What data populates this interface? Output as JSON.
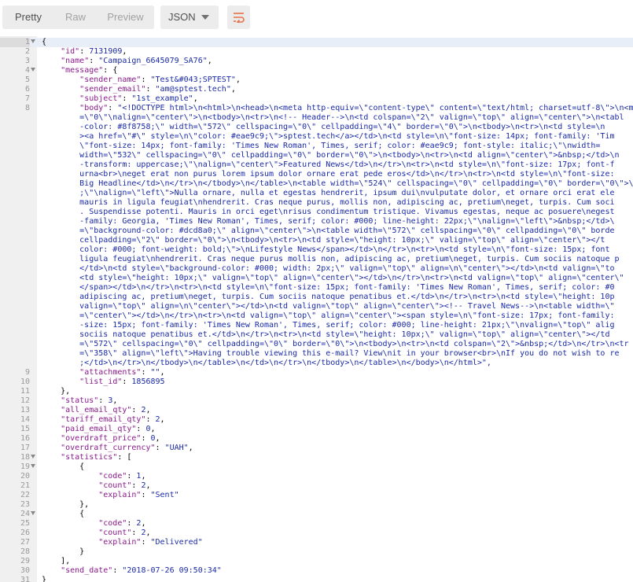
{
  "toolbar": {
    "view_tabs": [
      {
        "label": "Pretty",
        "active": true
      },
      {
        "label": "Raw",
        "active": false
      },
      {
        "label": "Preview",
        "active": false
      }
    ],
    "format_select": "JSON",
    "wrap_icon": "wrap-lines-icon",
    "accent_color": "#e8724a"
  },
  "editor": {
    "colors": {
      "key": "#8a1a8a",
      "string": "#1a2aa6",
      "number": "#1a2aa6",
      "gutter_bg": "#f0f0f0",
      "active_line": "#e8eef8"
    },
    "lines": [
      {
        "no": "1",
        "fold": true,
        "text": "{"
      },
      {
        "no": "2",
        "fold": false,
        "text": "    \"id\": 7131909,"
      },
      {
        "no": "3",
        "fold": false,
        "text": "    \"name\": \"Campaign_6645079_SA76\","
      },
      {
        "no": "4",
        "fold": true,
        "text": "    \"message\": {"
      },
      {
        "no": "5",
        "fold": false,
        "text": "        \"sender_name\": \"Test&#043;SPTEST\","
      },
      {
        "no": "6",
        "fold": false,
        "text": "        \"sender_email\": \"am@sptest.tech\","
      },
      {
        "no": "7",
        "fold": false,
        "text": "        \"subject\": \"1st_example\","
      },
      {
        "no": "8",
        "fold": false,
        "text": "        \"body\": \"<!DOCTYPE html>\\n<html>\\n<head>\\n<meta http-equiv=\\\"content-type\\\" content=\\\"text/html; charset=utf-8\\\">\\n<m"
      },
      {
        "no": "",
        "fold": false,
        "text": "        =\\\"0\\\"\\nalign=\\\"center\\\">\\n<tbody>\\n<tr>\\n<!-- Header-->\\n<td colspan=\\\"2\\\" valign=\\\"top\\\" align=\\\"center\\\">\\n<tabl"
      },
      {
        "no": "",
        "fold": false,
        "text": "        -color: #8f8758;\\\" width=\\\"572\\\" cellspacing=\\\"0\\\" cellpadding=\\\"4\\\" border=\\\"0\\\">\\n<tbody>\\n<tr>\\n<td style=\\n"
      },
      {
        "no": "",
        "fold": false,
        "text": "        ><a href=\\\"#\\\" style=\\n\\\"color: #eae9c9;\\\">sptest.tech</a></td>\\n<td style=\\n\\\"font-size: 14px; font-family: 'Tim"
      },
      {
        "no": "",
        "fold": false,
        "text": "        \\\"font-size: 14px; font-family: 'Times New Roman', Times, serif; color: #eae9c9; font-style: italic;\\\"\\nwidth="
      },
      {
        "no": "",
        "fold": false,
        "text": "        width=\\\"532\\\" cellspacing=\\\"0\\\" cellpadding=\\\"0\\\" border=\\\"0\\\">\\n<tbody>\\n<tr>\\n<td align=\\\"center\\\">&nbsp;</td>\\n"
      },
      {
        "no": "",
        "fold": false,
        "text": "        -transform: uppercase;\\\"\\nalign=\\\"center\\\">Featured News</td>\\n</tr>\\n<tr>\\n<td style=\\n\\\"font-size: 17px; font-f"
      },
      {
        "no": "",
        "fold": false,
        "text": "        urna<br>\\neget erat non purus lorem ipsum dolor ornare erat pede eros</td>\\n</tr>\\n<tr>\\n<td style=\\n\\\"font-size:"
      },
      {
        "no": "",
        "fold": false,
        "text": "        Big Headline</td>\\n</tr>\\n</tbody>\\n</table>\\n<table width=\\\"524\\\" cellspacing=\\\"0\\\" cellpadding=\\\"0\\\" border=\\\"0\\\">\\"
      },
      {
        "no": "",
        "fold": false,
        "text": "        ;\\\"\\nalign=\\\"left\\\">Nulla ornare, nulla et egestas hendrerit, ipsum dui\\nvulputate dolor, et ornare orci erat ele"
      },
      {
        "no": "",
        "fold": false,
        "text": "        mauris in ligula feugiat\\nhendrerit. Cras neque purus, mollis non, adipiscing ac, pretium\\neget, turpis. Cum soci"
      },
      {
        "no": "",
        "fold": false,
        "text": "        . Suspendisse potenti. Mauris in orci eget\\nrisus condimentum tristique. Vivamus egestas, neque ac posuere\\negest"
      },
      {
        "no": "",
        "fold": false,
        "text": "        -family: Georgia, 'Times New Roman', Times, serif; color: #000; line-height: 22px;\\\"\\nalign=\\\"left\\\">&nbsp;</td>\\"
      },
      {
        "no": "",
        "fold": false,
        "text": "        =\\\"background-color: #dcd8a0;\\\" align=\\\"center\\\">\\n<table width=\\\"572\\\" cellspacing=\\\"0\\\" cellpadding=\\\"0\\\" borde"
      },
      {
        "no": "",
        "fold": false,
        "text": "        cellpadding=\\\"2\\\" border=\\\"0\\\">\\n<tbody>\\n<tr>\\n<td style=\\\"height: 10px;\\\" valign=\\\"top\\\" align=\\\"center\\\"></t"
      },
      {
        "no": "",
        "fold": false,
        "text": "        color: #000; font-weight: bold;\\\">\\nLifestyle News</span></td>\\n</tr>\\n<tr>\\n<td style=\\n\\\"font-size: 15px; font"
      },
      {
        "no": "",
        "fold": false,
        "text": "        ligula feugiat\\nhendrerit. Cras neque purus mollis non, adipiscing ac, pretium\\neget, turpis. Cum sociis natoque p"
      },
      {
        "no": "",
        "fold": false,
        "text": "        </td>\\n<td style=\\\"background-color: #000; width: 2px;\\\" valign=\\\"top\\\" align=\\n\\\"center\\\"></td>\\n<td valign=\\\"to"
      },
      {
        "no": "",
        "fold": false,
        "text": "        <td style=\\\"height: 10px;\\\" valign=\\\"top\\\" align=\\\"center\\\"></td>\\n</tr>\\n<tr>\\n<td valign=\\\"top\\\" align=\\\"center\\\""
      },
      {
        "no": "",
        "fold": false,
        "text": "        </span></td>\\n</tr>\\n<tr>\\n<td style=\\n\\\"font-size: 15px; font-family: 'Times New Roman', Times, serif; color: #0"
      },
      {
        "no": "",
        "fold": false,
        "text": "        adipiscing ac, pretium\\neget, turpis. Cum sociis natoque penatibus et.</td>\\n</tr>\\n<tr>\\n<td style=\\\"height: 10p"
      },
      {
        "no": "",
        "fold": false,
        "text": "        valign=\\\"top\\\" align=\\n\\\"center\\\"></td>\\n<td valign=\\\"top\\\" align=\\\"center\\\"><!-- Travel News-->\\n<table width=\\\""
      },
      {
        "no": "",
        "fold": false,
        "text": "        =\\\"center\\\"></td>\\n</tr>\\n<tr>\\n<td valign=\\\"top\\\" align=\\\"center\\\"><span style=\\n\\\"font-size: 17px; font-family:"
      },
      {
        "no": "",
        "fold": false,
        "text": "        -size: 15px; font-family: 'Times New Roman', Times, serif; color: #000; line-height: 21px;\\\"\\nvalign=\\\"top\\\" alig"
      },
      {
        "no": "",
        "fold": false,
        "text": "        sociis natoque penatibus et.</td>\\n</tr>\\n<tr>\\n<td style=\\\"height: 10px;\\\" valign=\\\"top\\\" align=\\\"center\\\"></td"
      },
      {
        "no": "",
        "fold": false,
        "text": "        =\\\"572\\\" cellspacing=\\\"0\\\" cellpadding=\\\"0\\\" border=\\\"0\\\">\\n<tbody>\\n<tr>\\n<td colspan=\\\"2\\\">&nbsp;</td>\\n</tr>\\n<tr"
      },
      {
        "no": "",
        "fold": false,
        "text": "        =\\\"358\\\" align=\\\"left\\\">Having trouble viewing this e-mail? View\\nit in your browser<br>\\nIf you do not wish to re"
      },
      {
        "no": "",
        "fold": false,
        "text": "        ;</td>\\n</tr>\\n</tbody>\\n</table>\\n</td>\\n</tr>\\n</tbody>\\n</table>\\n</body>\\n</html>\","
      },
      {
        "no": "9",
        "fold": false,
        "text": "        \"attachments\": \"\","
      },
      {
        "no": "10",
        "fold": false,
        "text": "        \"list_id\": 1856895"
      },
      {
        "no": "11",
        "fold": false,
        "text": "    },"
      },
      {
        "no": "12",
        "fold": false,
        "text": "    \"status\": 3,"
      },
      {
        "no": "13",
        "fold": false,
        "text": "    \"all_email_qty\": 2,"
      },
      {
        "no": "14",
        "fold": false,
        "text": "    \"tariff_email_qty\": 2,"
      },
      {
        "no": "15",
        "fold": false,
        "text": "    \"paid_email_qty\": 0,"
      },
      {
        "no": "16",
        "fold": false,
        "text": "    \"overdraft_price\": 0,"
      },
      {
        "no": "17",
        "fold": false,
        "text": "    \"overdraft_currency\": \"UAH\","
      },
      {
        "no": "18",
        "fold": true,
        "text": "    \"statistics\": ["
      },
      {
        "no": "19",
        "fold": true,
        "text": "        {"
      },
      {
        "no": "20",
        "fold": false,
        "text": "            \"code\": 1,"
      },
      {
        "no": "21",
        "fold": false,
        "text": "            \"count\": 2,"
      },
      {
        "no": "22",
        "fold": false,
        "text": "            \"explain\": \"Sent\""
      },
      {
        "no": "23",
        "fold": false,
        "text": "        },"
      },
      {
        "no": "24",
        "fold": true,
        "text": "        {"
      },
      {
        "no": "25",
        "fold": false,
        "text": "            \"code\": 2,"
      },
      {
        "no": "26",
        "fold": false,
        "text": "            \"count\": 2,"
      },
      {
        "no": "27",
        "fold": false,
        "text": "            \"explain\": \"Delivered\""
      },
      {
        "no": "28",
        "fold": false,
        "text": "        }"
      },
      {
        "no": "29",
        "fold": false,
        "text": "    ],"
      },
      {
        "no": "30",
        "fold": false,
        "text": "    \"send_date\": \"2018-07-26 09:50:34\""
      },
      {
        "no": "31",
        "fold": false,
        "text": "}"
      }
    ]
  }
}
